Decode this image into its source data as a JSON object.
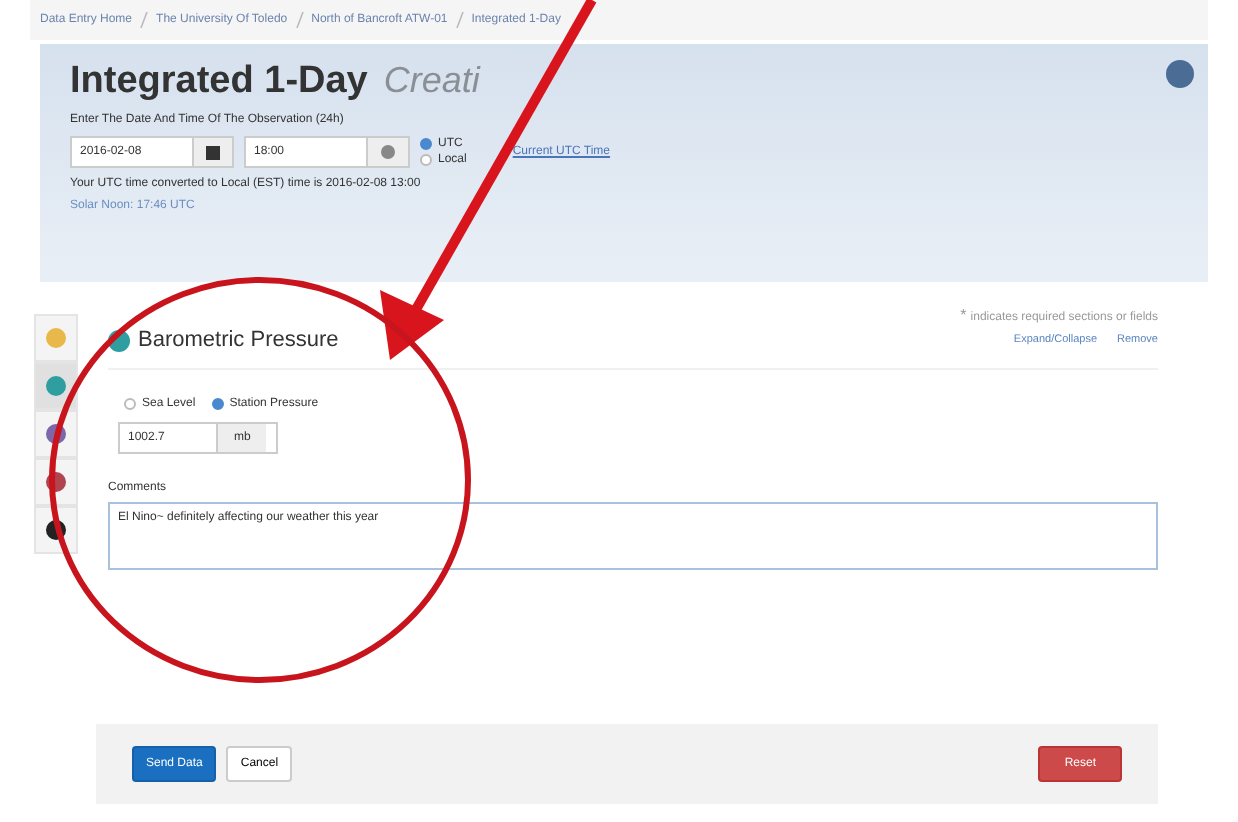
{
  "breadcrumb": [
    {
      "label": "Data Entry Home"
    },
    {
      "label": "The University Of Toledo"
    },
    {
      "label": "North of Bancroft ATW-01"
    },
    {
      "label": "Integrated 1-Day"
    }
  ],
  "header": {
    "title": "Integrated 1-Day",
    "status": "Creati",
    "prompt": "Enter The Date And Time Of The Observation (24h)",
    "date": "2016-02-08",
    "time": "18:00",
    "zones": [
      {
        "label": "UTC",
        "selected": true
      },
      {
        "label": "Local",
        "selected": false
      }
    ],
    "link": "Current UTC Time",
    "converted": "Your UTC time converted to Local (EST) time is 2016-02-08 13:00",
    "solar_noon": "Solar Noon: 17:46 UTC"
  },
  "side_tabs": [
    {
      "color": "#e8b94a",
      "selected": false
    },
    {
      "color": "#2f9ea0",
      "selected": true
    },
    {
      "color": "#7d67a8",
      "selected": false
    },
    {
      "color": "#b0454f",
      "selected": false
    },
    {
      "color": "#222222",
      "selected": false
    }
  ],
  "required_note": "indicates required sections or fields",
  "required_mark": "*",
  "actions": [
    "Expand/Collapse",
    "Remove"
  ],
  "section": {
    "title": "Barometric Pressure",
    "types": [
      {
        "label": "Sea Level",
        "selected": false
      },
      {
        "label": "Station Pressure",
        "selected": true
      }
    ],
    "value": "1002.7",
    "unit": "mb",
    "comments_label": "Comments",
    "comments": "El Nino~ definitely affecting our weather this year"
  },
  "buttons": [
    {
      "label": "Send Data",
      "kind": "primary"
    },
    {
      "label": "Cancel",
      "kind": "default"
    },
    {
      "label": "Reset",
      "kind": "danger"
    }
  ]
}
